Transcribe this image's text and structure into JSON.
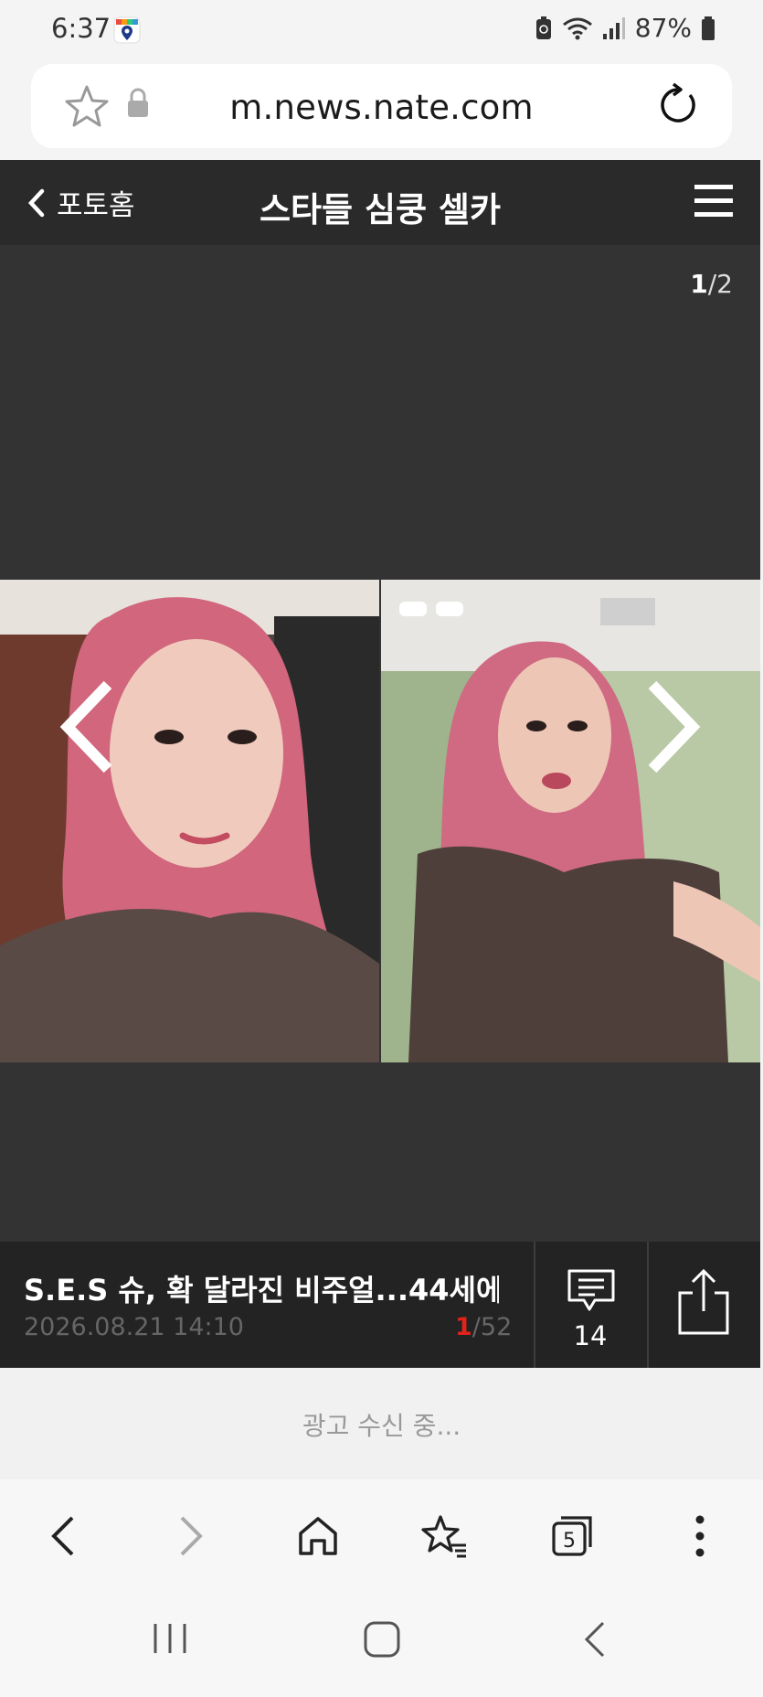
{
  "status_bar": {
    "time": "6:37",
    "battery": "87%"
  },
  "url_bar": {
    "url": "m.news.nate.com"
  },
  "header": {
    "back_label": "포토홈",
    "title": "스타들 심쿵 셀카"
  },
  "viewer": {
    "pager_current": "1",
    "pager_separator": "/",
    "pager_total": "2"
  },
  "article": {
    "title": "S.E.S 슈, 확 달라진 비주얼...44세에 ...",
    "date": "2026.08.21 14:10",
    "index_current": "1",
    "index_total": "/52",
    "comment_count": "14"
  },
  "ad": {
    "text": "광고 수신 중..."
  },
  "colors": {
    "header_bg": "#2a2a2a",
    "viewer_bg": "#333333",
    "info_bg": "#232323",
    "accent_red": "#e0231b"
  },
  "icons": {
    "status": [
      "location-app-icon",
      "battery-saver-icon",
      "wifi-icon",
      "signal-icon",
      "battery-icon"
    ],
    "url_bar": [
      "star-icon",
      "lock-icon",
      "reload-icon"
    ],
    "toolbar": [
      "back-icon",
      "forward-icon",
      "home-icon",
      "bookmarks-icon",
      "tabs-icon",
      "more-icon"
    ],
    "toolbar_tab_count": "5",
    "system": [
      "recents-icon",
      "home-icon",
      "back-icon"
    ]
  }
}
